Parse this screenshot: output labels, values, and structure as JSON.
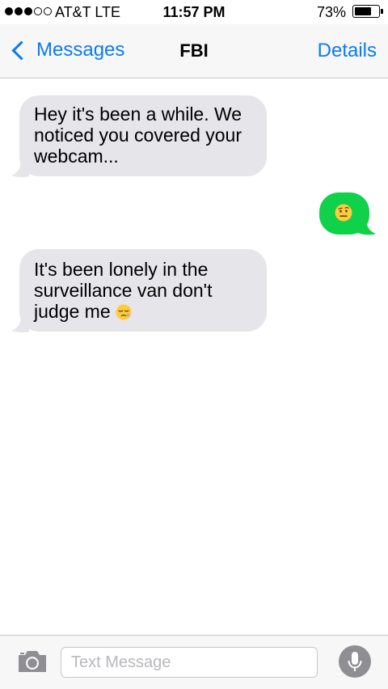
{
  "status_bar": {
    "carrier": "AT&T  LTE",
    "time": "11:57 PM",
    "battery_percent": "73%",
    "battery_level": 0.73,
    "signal_bars_filled": 3,
    "signal_bars_total": 5
  },
  "nav": {
    "back_label": "Messages",
    "title": "FBI",
    "details_label": "Details"
  },
  "messages": [
    {
      "direction": "received",
      "text": "Hey it's been a while. We noticed you covered your webcam..."
    },
    {
      "direction": "sent",
      "text": "",
      "emoji": "raised-eyebrow-face"
    },
    {
      "direction": "received",
      "text_lines": [
        "It's been lonely in the",
        "surveillance van don't",
        "judge me"
      ],
      "emoji": "sleepy-face"
    }
  ],
  "input_bar": {
    "placeholder": "Text Message",
    "value": ""
  },
  "colors": {
    "accent_blue": "#0a7af5",
    "sent_bubble": "#0fd14a",
    "received_bubble": "#e5e5ea",
    "bar_background": "#f7f7f8"
  }
}
